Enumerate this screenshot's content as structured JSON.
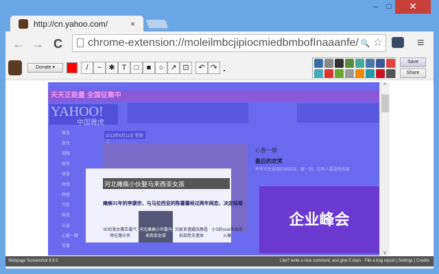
{
  "window": {
    "minimize": "–",
    "maximize": "□",
    "close": "✕"
  },
  "tab": {
    "title": "http://cn.yahoo.com/",
    "close": "×"
  },
  "toolbar": {
    "back": "←",
    "forward": "→",
    "reload": "C",
    "url": "chrome-extension://moleilmbcjipiocmiedbmbofInaaanfe/",
    "zoom": "🔍",
    "star": "☆",
    "menu": "≡"
  },
  "ext": {
    "donate": "Donate ▾",
    "color": "#ff0000",
    "tools": [
      "/",
      "~",
      "✱",
      "T",
      "□",
      "■",
      "○",
      "↗",
      "⊡",
      "↶",
      "↷"
    ],
    "save": "Save",
    "share": "Share",
    "share_colors": [
      "#3a6ea5",
      "#888",
      "#333",
      "#5a8a3a",
      "#4a9",
      "#4a76a8",
      "#3b5998",
      "#d44",
      "#4ab",
      "#d33",
      "#6a3",
      "#999",
      "#e80",
      "#29a",
      "#c12",
      "#555"
    ]
  },
  "page": {
    "banner": "天天正能量  全国征集中",
    "logo": "YAHOO!",
    "logo_sub": "中国雅虎",
    "date": "2013年6月11日 星期二",
    "nav": [
      "首页",
      "资讯",
      "视频",
      "娱乐",
      "体育",
      "时尚",
      "财经",
      "汽车",
      "科技",
      "公益",
      "心香一瓣",
      "军事"
    ],
    "slide_caption": "河北瘫痪小伙娶马来西亚女孩",
    "headline": "瘫痪31年的李康宗，与马拉西亚的陈蕾蕾经过两年网恋，决定结婚",
    "thumbs": [
      "90后美女赛车霸气停在路中央",
      "河北瘫痪小伙娶马来西亚女孩",
      "刘家良遗孀张静晶抵部悉夫遗体",
      "小S的mini单曲很火爆"
    ],
    "side_title": "心香一瓣",
    "side_head": "最后的欢笑",
    "side_text": "爷爷天生倔强的顽固派，屋一刻，忍有人要逼他去家",
    "promo": "企业峰会"
  },
  "footer": {
    "version": "Webpage Screenshot 9.9.5",
    "like": "Like? write a nice comment, and give 5 stars",
    "bug": "File a bug report",
    "settings": "Settings",
    "credits": "Credits",
    "sep": "|"
  }
}
